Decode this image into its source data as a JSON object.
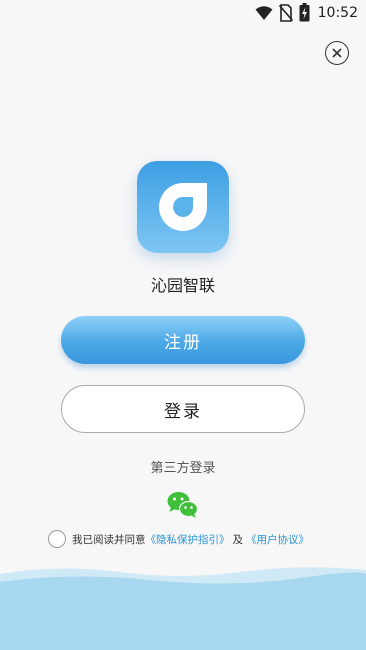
{
  "status_bar": {
    "time": "10:52"
  },
  "app": {
    "name": "沁园智联"
  },
  "buttons": {
    "register": "注册",
    "login": "登录"
  },
  "third_party": {
    "label": "第三方登录"
  },
  "agreement": {
    "prefix": "我已阅读并同意",
    "privacy_link": "《隐私保护指引》",
    "and": "及",
    "user_agreement_link": "《用户协议》"
  },
  "icons": {
    "close": "close-circle-icon",
    "wechat": "wechat-icon",
    "wifi": "wifi-icon",
    "no_sim": "no-sim-icon",
    "battery": "battery-charging-icon"
  },
  "colors": {
    "accent": "#4aa8e6",
    "link": "#2a95d8",
    "wechat": "#3fbf3a",
    "wave": "#a8d8f0"
  }
}
